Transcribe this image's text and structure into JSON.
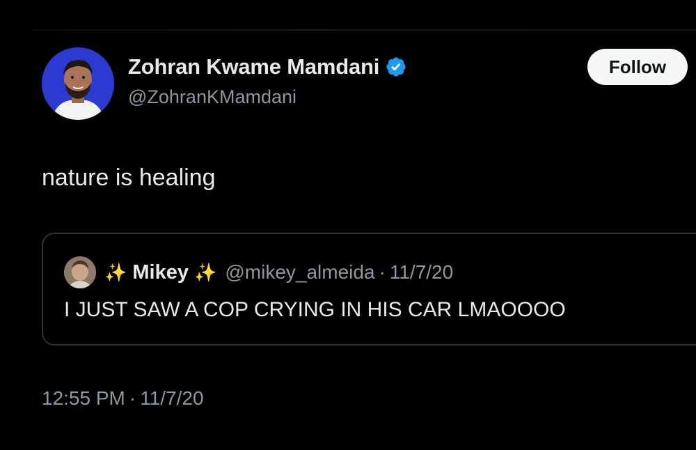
{
  "author": {
    "name": "Zohran Kwame Mamdani",
    "handle": "@ZohranKMamdani",
    "verified": true,
    "avatar_icon": "profile-photo",
    "avatar_bg": "#2d3ad1"
  },
  "follow": {
    "label": "Follow"
  },
  "tweet": {
    "text": "nature is healing",
    "time": "12:55 PM",
    "separator": "·",
    "date": "11/7/20"
  },
  "quoted": {
    "sparkle_left": "✨",
    "name": "Mikey",
    "sparkle_right": "✨",
    "handle": "@mikey_almeida",
    "separator": "·",
    "date": "11/7/20",
    "text": "I JUST SAW A COP CRYING IN HIS CAR LMAOOOO"
  },
  "colors": {
    "background": "#000000",
    "text_primary": "#e7e9ea",
    "text_secondary": "#8b98a5",
    "verified_blue": "#1d9bf0",
    "follow_bg": "#f7f9f9"
  }
}
